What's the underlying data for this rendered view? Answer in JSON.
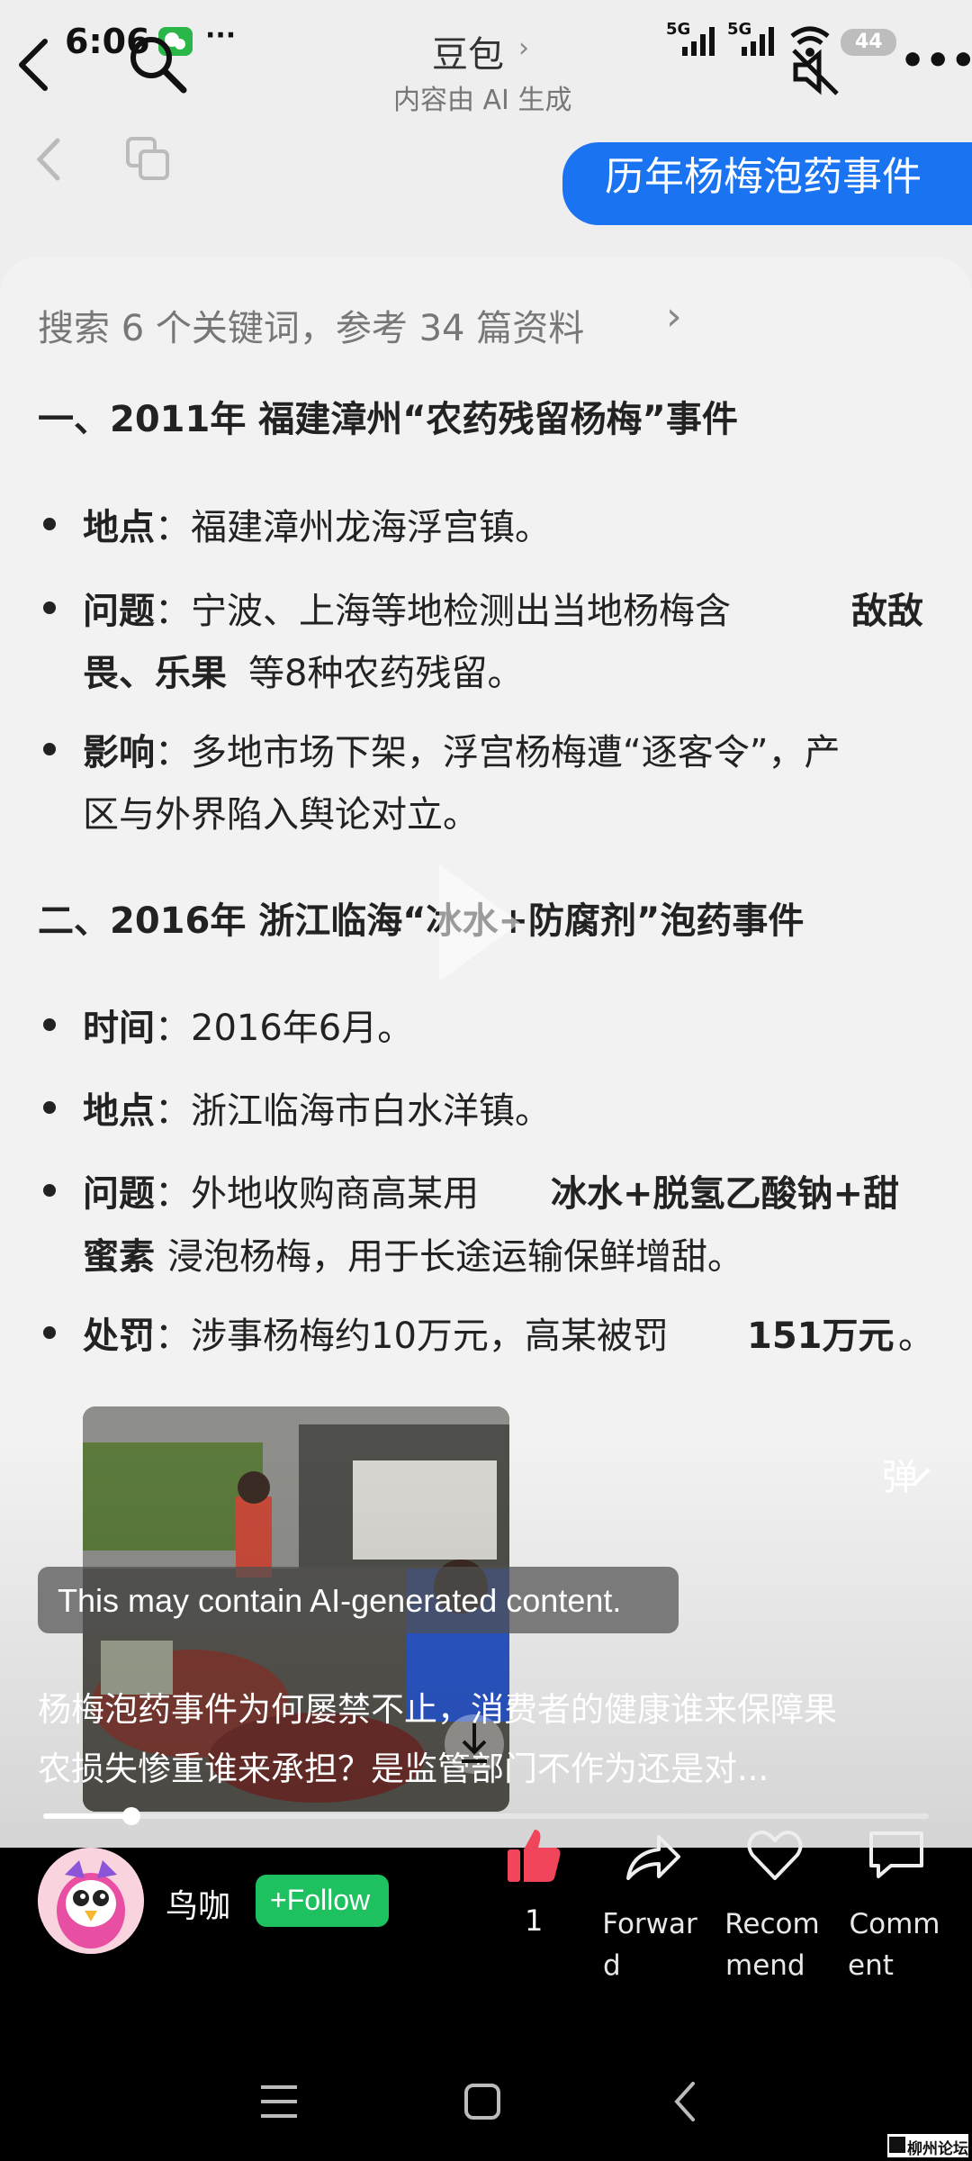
{
  "status_bar": {
    "time": "6:06",
    "network_1": "5G",
    "network_2": "5G",
    "battery": "44"
  },
  "header": {
    "title": "豆包",
    "subtitle": "内容由 AI 生成"
  },
  "chat": {
    "user_message": "历年杨梅泡药事件"
  },
  "answer": {
    "search_summary": "搜索 6 个关键词，参考 34 篇资料",
    "section1": {
      "heading": "一、2011年 福建漳州“农药残留杨梅”事件",
      "location_label": "地点",
      "location_text": "：福建漳州龙海浮宫镇。",
      "problem_label": "问题",
      "problem_text_1": "：宁波、上海等地检测出当地杨梅含",
      "problem_bold_1": "敌敌",
      "problem_bold_2": "畏、乐果",
      "problem_text_2": "等8种农药残留。",
      "impact_label": "影响",
      "impact_line_1": "：多地市场下架，浮宫杨梅遭“逐客令”，产",
      "impact_line_2": "区与外界陷入舆论对立。"
    },
    "section2": {
      "heading": "二、2016年 浙江临海“冰水+防腐剂”泡药事件",
      "time_label": "时间",
      "time_text": "：2016年6月。",
      "location_label": "地点",
      "location_text": "：浙江临海市白水洋镇。",
      "problem_label": "问题",
      "problem_text_1": "：外地收购商高某用",
      "problem_bold_1": "冰水+脱氢乙酸钠+甜",
      "problem_bold_2": "蜜素",
      "problem_text_2": "浸泡杨梅，用于长途运输保鲜增甜。",
      "penalty_label": "处罚",
      "penalty_text": "：涉事杨梅约10万元，高某被罚",
      "penalty_bold": "151万元",
      "penalty_end": "。"
    }
  },
  "video": {
    "danmaku_label": "弹",
    "ai_notice": "This may contain AI-generated content.",
    "caption_line_1": "杨梅泡药事件为何屡禁不止，消费者的健康谁来保障果",
    "caption_line_2": "农损失惨重谁来承担？是监管部门不作为还是对...",
    "progress": 0.1
  },
  "author": {
    "name": "鸟咖",
    "follow_label": "+Follow"
  },
  "actions": {
    "like_count": "1",
    "forward_label_1": "Forwar",
    "forward_label_2": "d",
    "recommend_label_1": "Recom",
    "recommend_label_2": "mend",
    "comment_label_1": "Comm",
    "comment_label_2": "ent"
  },
  "watermark": "柳州论坛",
  "colors": {
    "accent_blue": "#1a73f0",
    "follow_green": "#1ec15f",
    "like_red": "#f0455a"
  }
}
